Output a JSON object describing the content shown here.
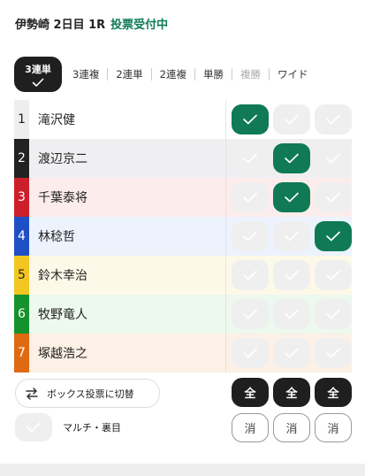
{
  "header": {
    "race": "伊勢崎 2日目 1R",
    "status": "投票受付中"
  },
  "bet_types": [
    {
      "label": "3連単",
      "active": true
    },
    {
      "label": "3連複",
      "active": false
    },
    {
      "label": "2連単",
      "active": false
    },
    {
      "label": "2連複",
      "active": false
    },
    {
      "label": "単勝",
      "active": false
    },
    {
      "label": "複勝",
      "active": false,
      "disabled": true
    },
    {
      "label": "ワイド",
      "active": false
    }
  ],
  "colors": {
    "accent": "#0f7a55",
    "dark": "#1f1f1f",
    "cell_off": "#efefef"
  },
  "riders": [
    {
      "num": "1",
      "name": "滝沢健",
      "num_bg": "#eeeeee",
      "num_fg": "#222222",
      "row_bg": "#ffffff",
      "sel": [
        true,
        false,
        false
      ]
    },
    {
      "num": "2",
      "name": "渡辺京二",
      "num_bg": "#222222",
      "num_fg": "#ffffff",
      "row_bg": "#efeff2",
      "sel": [
        false,
        true,
        false
      ]
    },
    {
      "num": "3",
      "name": "千葉泰将",
      "num_bg": "#cc1f2a",
      "num_fg": "#ffffff",
      "row_bg": "#fdecec",
      "sel": [
        false,
        true,
        false
      ]
    },
    {
      "num": "4",
      "name": "林稔哲",
      "num_bg": "#1f4fc4",
      "num_fg": "#ffffff",
      "row_bg": "#edf3fd",
      "sel": [
        false,
        false,
        true
      ]
    },
    {
      "num": "5",
      "name": "鈴木幸治",
      "num_bg": "#f3c520",
      "num_fg": "#222222",
      "row_bg": "#fdf9e8",
      "sel": [
        false,
        false,
        false
      ]
    },
    {
      "num": "6",
      "name": "牧野竜人",
      "num_bg": "#15922e",
      "num_fg": "#ffffff",
      "row_bg": "#edf8ee",
      "sel": [
        false,
        false,
        false
      ]
    },
    {
      "num": "7",
      "name": "塚越浩之",
      "num_bg": "#e06a12",
      "num_fg": "#ffffff",
      "row_bg": "#fdf0e6",
      "sel": [
        false,
        false,
        false
      ]
    }
  ],
  "controls": {
    "box_switch": "ボックス投票に切替",
    "multi": "マルチ・裏目",
    "all": [
      "全",
      "全",
      "全"
    ],
    "clear": [
      "消",
      "消",
      "消"
    ]
  }
}
